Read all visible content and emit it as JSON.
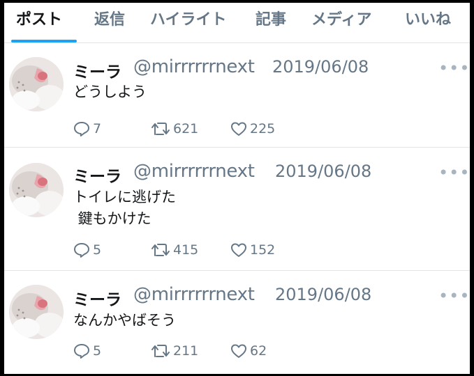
{
  "tabs": [
    {
      "label": "ポスト",
      "active": true
    },
    {
      "label": "返信"
    },
    {
      "label": "ハイライト"
    },
    {
      "label": "記事"
    },
    {
      "label": "メディア"
    },
    {
      "label": "いいね"
    }
  ],
  "tweets": [
    {
      "name": "ミーラ",
      "handle": "@mirrrrrrnext",
      "date": "2019/06/08",
      "more": "•••",
      "text": "どうしよう",
      "replies": "7",
      "retweets": "621",
      "likes": "225"
    },
    {
      "name": "ミーラ",
      "handle": "@mirrrrrrnext",
      "date": "2019/06/08",
      "more": "•••",
      "text": "トイレに逃げた\n 鍵もかけた",
      "replies": "5",
      "retweets": "415",
      "likes": "152"
    },
    {
      "name": "ミーラ",
      "handle": "@mirrrrrrnext",
      "date": "2019/06/08",
      "more": "•••",
      "text": "なんかやばそう",
      "replies": "5",
      "retweets": "211",
      "likes": "62"
    }
  ],
  "icons": {
    "reply": "reply-icon",
    "retweet": "retweet-icon",
    "like": "heart-icon",
    "more": "more-icon"
  },
  "colors": {
    "accent": "#1da1f2",
    "text": "#14171a",
    "secondary": "#657786"
  }
}
